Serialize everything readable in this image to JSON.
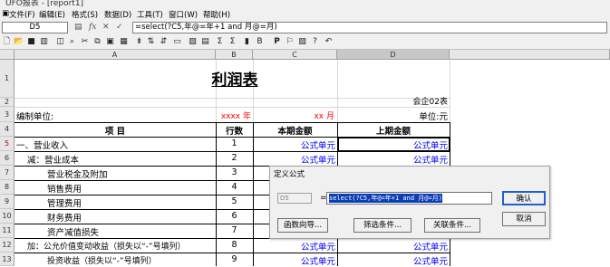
{
  "window": {
    "title": "UFO报表 - [report1]"
  },
  "menu": [
    {
      "label": "文件(F)"
    },
    {
      "label": "编辑(E)"
    },
    {
      "label": "格式(S)"
    },
    {
      "label": "数据(D)"
    },
    {
      "label": "工具(T)"
    },
    {
      "label": "窗口(W)"
    },
    {
      "label": "帮助(H)"
    }
  ],
  "formula_bar": {
    "cell_ref": "D5",
    "formula": "=select(?C5,年@=年+1 and 月@=月)"
  },
  "columns": [
    "A",
    "B",
    "C",
    "D"
  ],
  "rows": [
    "1",
    "2",
    "3",
    "4",
    "5",
    "6",
    "7",
    "8",
    "9",
    "10",
    "11",
    "12",
    "13"
  ],
  "report": {
    "title": "利润表",
    "form_no": "会企02表",
    "unit_label": "编制单位:",
    "year": "xxxx 年",
    "month": "xx 月",
    "currency_unit": "单位:元",
    "headers": {
      "item": "项          目",
      "line_no": "行数",
      "current": "本期金额",
      "previous": "上期金额"
    },
    "lines": [
      {
        "item": "一、营业收入",
        "line_no": "1",
        "current": "公式单元",
        "previous": "公式单元"
      },
      {
        "item": "减：营业成本",
        "line_no": "2",
        "current": "公式单元",
        "previous": "公式单元"
      },
      {
        "item": "营业税金及附加",
        "line_no": "3",
        "current": "",
        "previous": ""
      },
      {
        "item": "销售费用",
        "line_no": "4",
        "current": "",
        "previous": ""
      },
      {
        "item": "管理费用",
        "line_no": "5",
        "current": "",
        "previous": ""
      },
      {
        "item": "财务费用",
        "line_no": "6",
        "current": "",
        "previous": ""
      },
      {
        "item": "资产减值损失",
        "line_no": "7",
        "current": "",
        "previous": ""
      },
      {
        "item": "加：公允价值变动收益（损失以“-”号填列）",
        "line_no": "8",
        "current": "公式单元",
        "previous": "公式单元"
      },
      {
        "item": "投资收益（损失以“-”号填列）",
        "line_no": "9",
        "current": "公式单元",
        "previous": "公式单元"
      }
    ]
  },
  "dialog": {
    "title": "定义公式",
    "cell_ref": "D5",
    "equals": "=",
    "formula": "select(?C5,年@=年+1 and 月@=月)",
    "buttons": {
      "ok": "确认",
      "cancel": "取消",
      "func_wizard": "函数向导...",
      "filter": "筛选条件...",
      "relation": "关联条件..."
    }
  }
}
